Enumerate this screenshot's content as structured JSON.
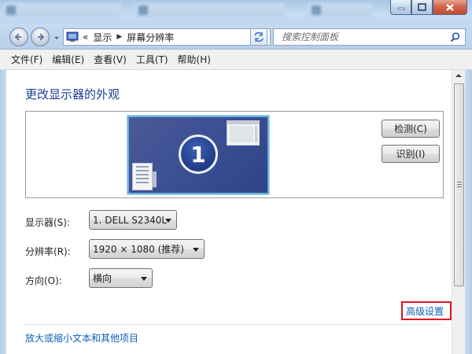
{
  "window_controls": {
    "minimize": "minimize-icon",
    "maximize": "maximize-icon",
    "close": "close-icon"
  },
  "address_bar": {
    "overflow": "«",
    "breadcrumbs": [
      "显示",
      "屏幕分辨率"
    ],
    "separator": "▶"
  },
  "search": {
    "placeholder": "搜索控制面板"
  },
  "menu": {
    "items": [
      "文件(F)",
      "编辑(E)",
      "查看(V)",
      "工具(T)",
      "帮助(H)"
    ]
  },
  "main": {
    "title": "更改显示器的外观",
    "monitor_number": "1",
    "detect_button": "检测(C)",
    "identify_button": "识别(I)",
    "display": {
      "label": "显示器(S):",
      "value": "1. DELL S2340L"
    },
    "resolution": {
      "label": "分辨率(R):",
      "value": "1920 × 1080 (推荐)"
    },
    "orientation": {
      "label": "方向(O):",
      "value": "横向"
    },
    "advanced_link": "高级设置",
    "text_size_link": "放大或缩小文本和其他项目"
  },
  "colors": {
    "title_blue": "#1c3f94",
    "link_blue": "#0b5fb8",
    "highlight_red": "#e0141d"
  }
}
